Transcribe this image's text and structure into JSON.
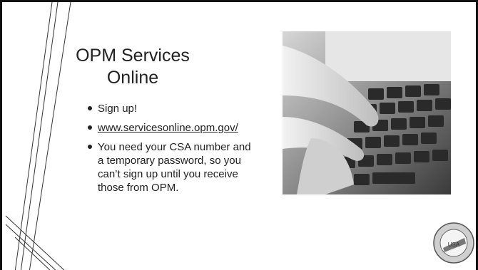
{
  "slide": {
    "title": "OPM Services Online",
    "bullets": [
      {
        "text": "Sign up!",
        "is_link": false
      },
      {
        "text": "www.servicesonline.opm.gov/",
        "is_link": true
      },
      {
        "text": "You need your CSA number and a temporary password, so you can’t sign up until you receive those from OPM.",
        "is_link": false
      }
    ],
    "photo": {
      "subject": "hands typing on laptop keyboard",
      "style": "black and white"
    },
    "logo": {
      "text_top": "NATIONAL ASSOCIATION OF LETTER CARRIERS",
      "text_center": "USA"
    }
  },
  "colors": {
    "text": "#222222",
    "border": "#111111",
    "background": "#ffffff"
  }
}
